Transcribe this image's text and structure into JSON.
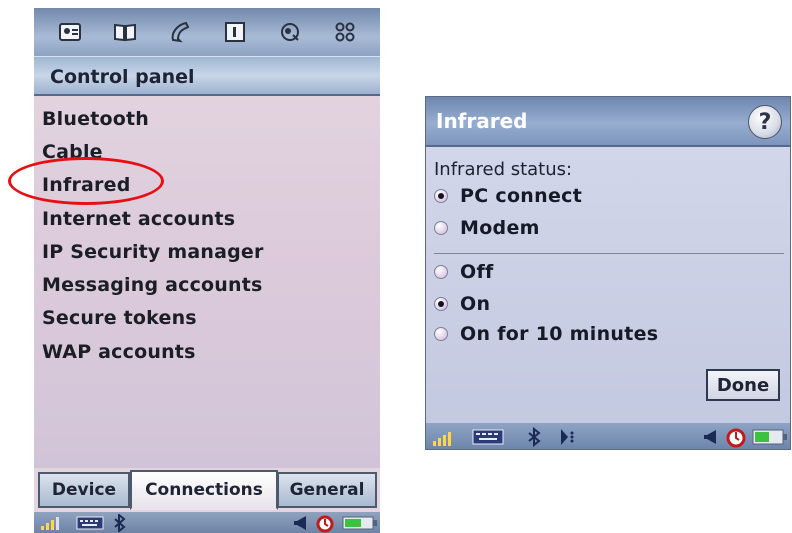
{
  "left_screen": {
    "app_icons": [
      "contacts-icon",
      "book-icon",
      "phone-icon",
      "calendar-icon",
      "internet-icon",
      "apps-grid-icon"
    ],
    "title": "Control panel",
    "items": [
      {
        "label": "Bluetooth"
      },
      {
        "label": "Cable"
      },
      {
        "label": "Infrared",
        "highlighted": true
      },
      {
        "label": "Internet accounts"
      },
      {
        "label": "IP Security manager"
      },
      {
        "label": "Messaging accounts"
      },
      {
        "label": "Secure tokens"
      },
      {
        "label": "WAP accounts"
      }
    ],
    "tabs": [
      {
        "label": "Device"
      },
      {
        "label": "Connections",
        "active": true
      },
      {
        "label": "General"
      }
    ],
    "status_icons": [
      "signal-icon",
      "keyboard-icon",
      "bluetooth-icon",
      "volume-icon",
      "alarm-icon",
      "battery-icon"
    ]
  },
  "right_screen": {
    "title": "Infrared",
    "help_label": "?",
    "status_label": "Infrared status:",
    "mode_options": [
      {
        "label": "PC connect",
        "selected": true
      },
      {
        "label": "Modem",
        "selected": false
      }
    ],
    "power_options": [
      {
        "label": "Off",
        "selected": false
      },
      {
        "label": "On",
        "selected": true
      },
      {
        "label": "On for 10 minutes",
        "selected": false
      }
    ],
    "done_label": "Done",
    "status_icons": [
      "signal-icon",
      "keyboard-icon",
      "bluetooth-icon",
      "infrared-icon",
      "volume-icon",
      "alarm-icon",
      "battery-icon"
    ]
  },
  "colors": {
    "highlight_circle": "#e60f14",
    "title_bar": "#8ea3c2",
    "list_background": "#dccbdb"
  }
}
